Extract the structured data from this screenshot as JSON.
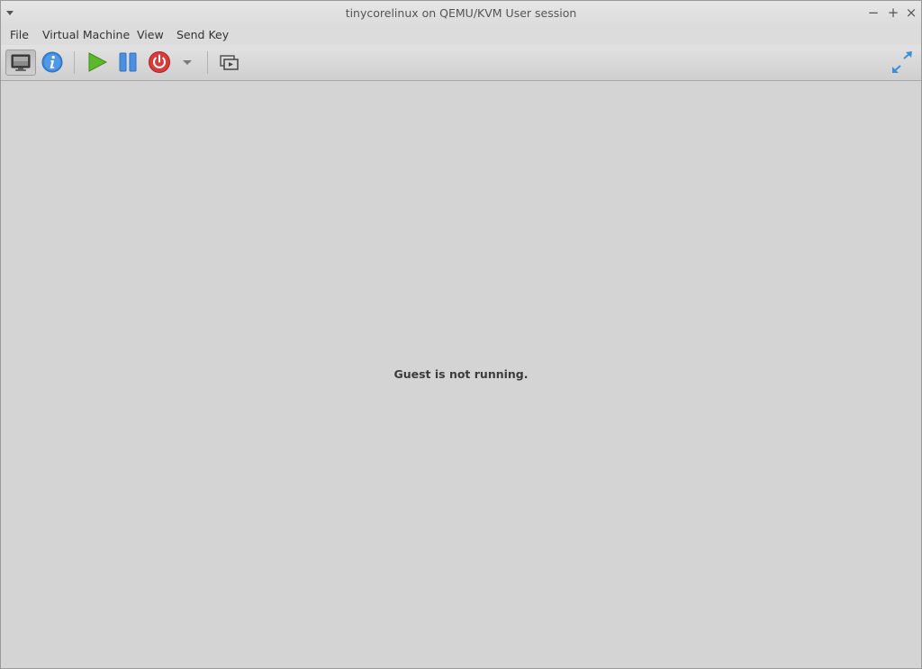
{
  "window": {
    "title": "tinycorelinux on QEMU/KVM User session",
    "controls": {
      "minimize": "−",
      "maximize": "+",
      "close": "×"
    }
  },
  "menubar": {
    "items": [
      {
        "label": "File"
      },
      {
        "label": "Virtual Machine"
      },
      {
        "label": "View"
      },
      {
        "label": "Send Key"
      }
    ]
  },
  "toolbar": {
    "buttons": [
      {
        "icon": "monitor-icon",
        "state": "pressed"
      },
      {
        "icon": "info-icon"
      },
      {
        "icon": "play-icon",
        "color": "#5cb82c"
      },
      {
        "icon": "pause-icon",
        "color": "#4a90e2"
      },
      {
        "icon": "power-icon",
        "color": "#d93a3a"
      },
      {
        "icon": "chevron-down-icon"
      },
      {
        "icon": "snapshots-icon"
      },
      {
        "icon": "fullscreen-icon",
        "color": "#3b8fd9"
      }
    ]
  },
  "content": {
    "status_text": "Guest is not running."
  }
}
